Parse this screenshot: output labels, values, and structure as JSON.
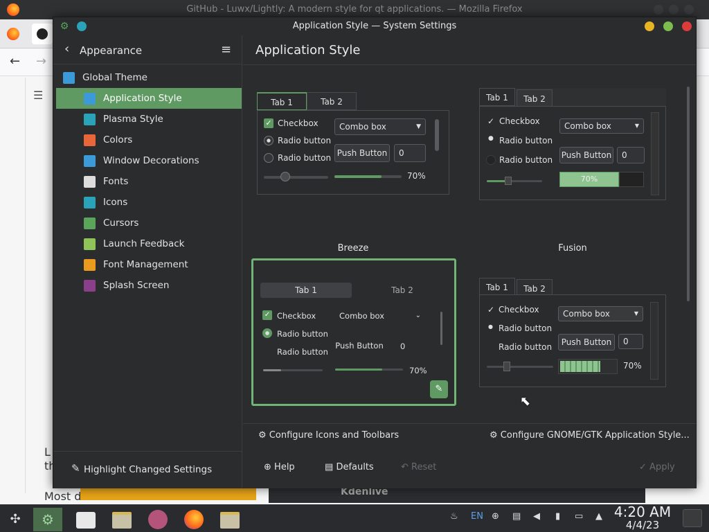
{
  "browser": {
    "title": "GitHub - Luwx/Lightly: A modern style for qt applications. — Mozilla Firefox",
    "body_line1": "L",
    "body_line2": "th",
    "body_line3": "Most d",
    "img2_text": "Kdenlive"
  },
  "window": {
    "title": "Application Style — System Settings"
  },
  "sidebar": {
    "header": "Appearance",
    "items": [
      {
        "label": "Global Theme",
        "icon": "global-theme-icon",
        "color": "#3d9ad8"
      },
      {
        "label": "Application Style",
        "icon": "application-style-icon",
        "color": "#3d9ad8"
      },
      {
        "label": "Plasma Style",
        "icon": "plasma-style-icon",
        "color": "#2aa3b8"
      },
      {
        "label": "Colors",
        "icon": "colors-icon",
        "color": "#e8663a"
      },
      {
        "label": "Window Decorations",
        "icon": "window-decorations-icon",
        "color": "#3d9ad8"
      },
      {
        "label": "Fonts",
        "icon": "fonts-icon",
        "color": "#dddddd"
      },
      {
        "label": "Icons",
        "icon": "icons-icon",
        "color": "#2aa3b8"
      },
      {
        "label": "Cursors",
        "icon": "cursors-icon",
        "color": "#5aa55a"
      },
      {
        "label": "Launch Feedback",
        "icon": "launch-feedback-icon",
        "color": "#8fc35a"
      },
      {
        "label": "Font Management",
        "icon": "font-management-icon",
        "color": "#e89b1e"
      },
      {
        "label": "Splash Screen",
        "icon": "splash-screen-icon",
        "color": "#8a3f8a"
      }
    ],
    "selected": "Application Style",
    "footer": "Highlight Changed Settings"
  },
  "main": {
    "title": "Application Style",
    "styles": [
      {
        "name": "Breeze",
        "tab1": "Tab 1",
        "tab2": "Tab 2",
        "checkbox": "Checkbox",
        "radio1": "Radio button",
        "radio2": "Radio button",
        "combo": "Combo box",
        "push": "Push Button",
        "spin": "0",
        "progress": "70%"
      },
      {
        "name": "Fusion",
        "tab1": "Tab 1",
        "tab2": "Tab 2",
        "checkbox": "Checkbox",
        "radio1": "Radio button",
        "radio2": "Radio button",
        "combo": "Combo box",
        "push": "Push Button",
        "spin": "0",
        "progress": "70%"
      },
      {
        "name": "",
        "tab1": "Tab 1",
        "tab2": "Tab 2",
        "checkbox": "Checkbox",
        "radio1": "Radio button",
        "radio2": "Radio button",
        "combo": "Combo box",
        "push": "Push Button",
        "spin": "0",
        "progress": "70%"
      },
      {
        "name": "",
        "tab1": "Tab 1",
        "tab2": "Tab 2",
        "checkbox": "Checkbox",
        "radio1": "Radio button",
        "radio2": "Radio button",
        "combo": "Combo box",
        "push": "Push Button",
        "spin": "0",
        "progress": "70%"
      }
    ],
    "configure_icons": "Configure Icons and Toolbars",
    "configure_gtk": "Configure GNOME/GTK Application Style...",
    "help": "Help",
    "defaults": "Defaults",
    "reset": "Reset",
    "apply": "Apply"
  },
  "taskbar": {
    "lang": "EN",
    "time": "4:20 AM",
    "date": "4/4/23"
  },
  "colors": {
    "accent": "#5f9a63"
  }
}
